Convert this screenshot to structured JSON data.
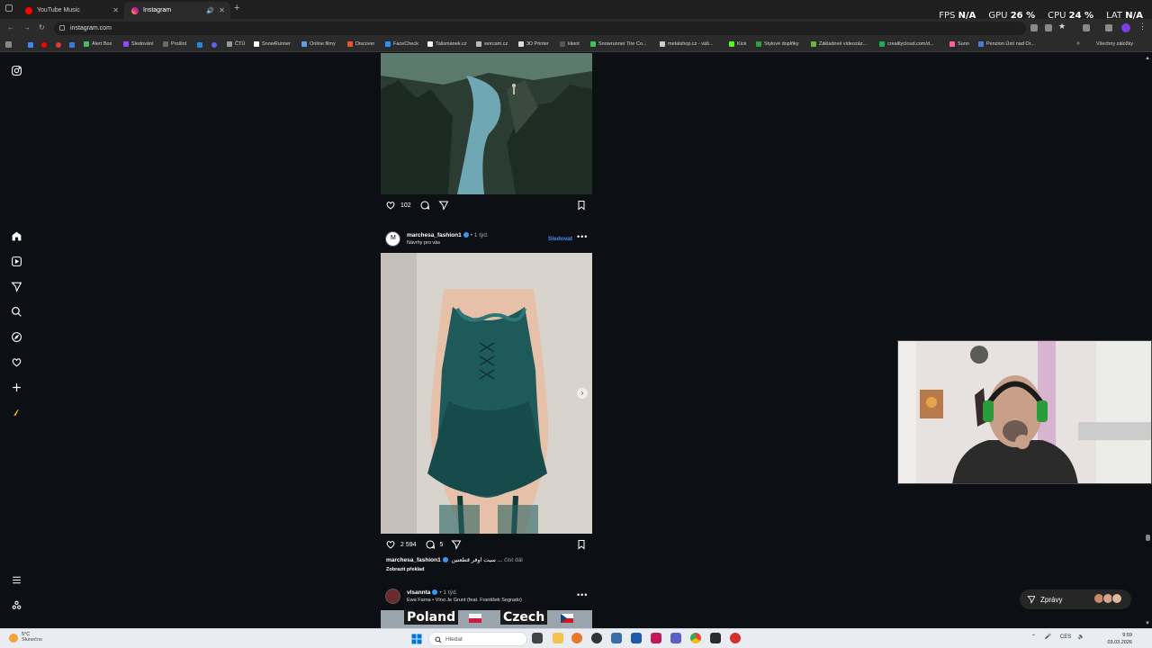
{
  "browser": {
    "tabs": [
      {
        "title": "YouTube Music",
        "favicon_color": "#ff0000",
        "active": false
      },
      {
        "title": "Instagram",
        "favicon_color": "#d62976",
        "active": true
      }
    ],
    "url": "instagram.com",
    "bookmarks": [
      "Alert Box",
      "Sledování",
      "Prošlot",
      "ČTÚ",
      "SnowRunner",
      "Online filmy",
      "Discover",
      "FaceCheck",
      "Talismánek.cz",
      "worcam.cz",
      "3D Printer",
      "klient",
      "Snowrunner Tire Co...",
      "metalshop.cz - väš...",
      "Kick",
      "Stylové doplňky",
      "Základové videozáz...",
      "crealitycloud.com/d...",
      "Suno",
      "Penzion Ústí nad Or..."
    ],
    "bookmarks_all": "Všechny záložky"
  },
  "hud": {
    "fps_label": "FPS",
    "fps_value": "N/A",
    "gpu_label": "GPU",
    "gpu_value": "26 %",
    "cpu_label": "CPU",
    "cpu_value": "24 %",
    "lat_label": "LAT",
    "lat_value": "N/A"
  },
  "sidebar": {
    "icons": [
      "instagram-logo",
      "home",
      "reels",
      "direct-send",
      "search",
      "explore",
      "notifications-heart",
      "create-plus",
      "profile",
      "menu",
      "threads"
    ]
  },
  "feed": {
    "post1": {
      "likes": "102"
    },
    "post2": {
      "username": "marchesa_fashion1",
      "time": "• 1 týd.",
      "subtitle": "Návrhy pro vás",
      "follow": "Sledovat",
      "likes": "2 594",
      "comments": "5",
      "caption_user": "marchesa_fashion1",
      "caption_text": "سيت اوفر قطعتين ...",
      "caption_more": "číst dál",
      "translate": "Zobrazit překlad"
    },
    "post3": {
      "username": "vlsannta",
      "time": "• 1 týd.",
      "subtitle": "Ewa Farna • Víno Je Grunt (feat. František Segrado)",
      "banner_left": "Poland",
      "banner_right": "Czech"
    }
  },
  "messages": {
    "label": "Zprávy"
  },
  "taskbar": {
    "weather_temp": "5°C",
    "weather_cond": "Slunečno",
    "search_placeholder": "Hledat",
    "lang": "CES",
    "time": "9:59",
    "date": "03.03.2026"
  },
  "colors": {
    "accent": "#4a8df8",
    "background": "#0c1014",
    "verified": "#3897f0"
  }
}
